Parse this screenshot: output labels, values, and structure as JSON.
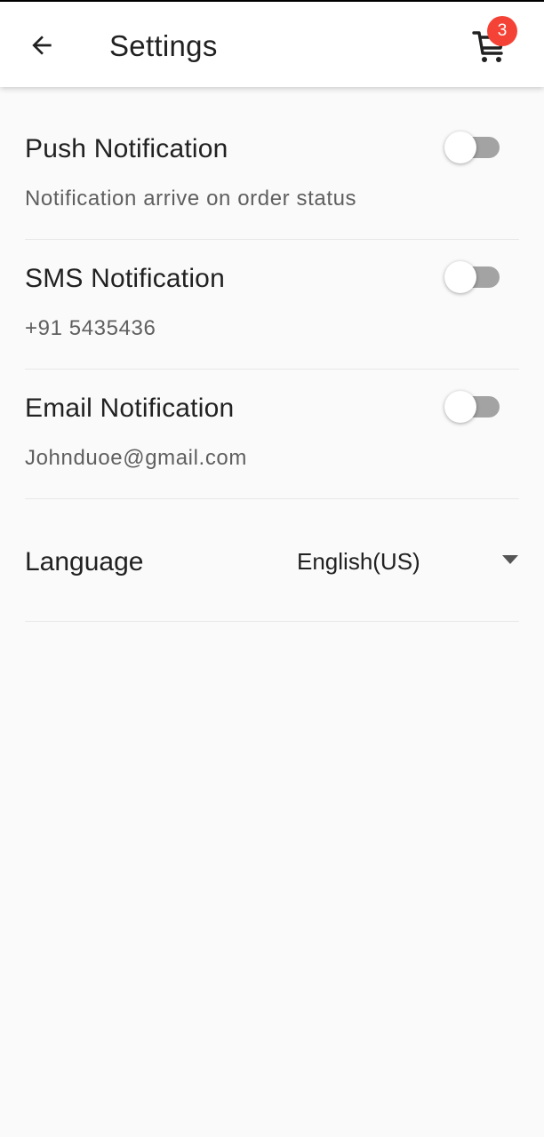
{
  "appbar": {
    "title": "Settings",
    "back_icon": "arrow-left-icon",
    "cart_icon": "shopping-cart-icon",
    "cart_count": "3",
    "badge_color": "#f44336"
  },
  "settings": {
    "push": {
      "title": "Push Notification",
      "subtitle": "Notification arrive on order status",
      "enabled": false
    },
    "sms": {
      "title": "SMS Notification",
      "subtitle": "+91 5435436",
      "enabled": false
    },
    "email": {
      "title": "Email Notification",
      "subtitle": "Johnduoe@gmail.com",
      "enabled": false
    },
    "language": {
      "label": "Language",
      "selected": "English(US)",
      "caret_icon": "caret-down-icon"
    }
  }
}
